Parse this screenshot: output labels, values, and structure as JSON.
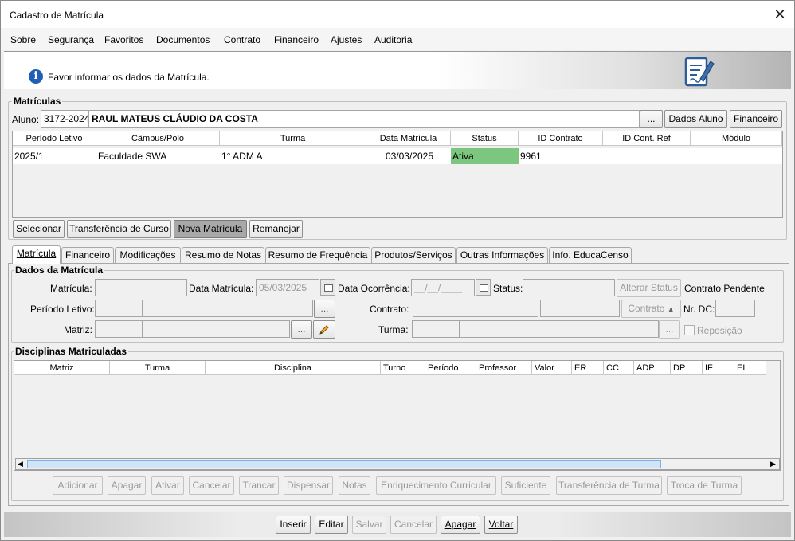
{
  "window": {
    "title": "Cadastro de Matrícula"
  },
  "menu": [
    "Sobre",
    "Segurança",
    "Favoritos",
    "Documentos",
    "Contrato",
    "Financeiro",
    "Ajustes",
    "Auditoria"
  ],
  "info": {
    "message": "Favor informar os dados da Matrícula."
  },
  "matriculas": {
    "group_title": "Matrículas",
    "aluno_label": "Aluno:",
    "aluno_code": "3172-2024",
    "aluno_name": "RAUL MATEUS CLÁUDIO DA COSTA",
    "browse_label": "...",
    "dados_aluno_label": "Dados Aluno",
    "financeiro_label": "Financeiro",
    "columns": [
      "Período Letivo",
      "Câmpus/Polo",
      "Turma",
      "Data Matrícula",
      "Status",
      "ID Contrato",
      "ID Cont. Ref",
      "Módulo"
    ],
    "rows": [
      {
        "periodo": "2025/1",
        "campus": "Faculdade SWA",
        "turma": "1° ADM A",
        "data": "03/03/2025",
        "status": "Ativa",
        "id_contrato": "9961",
        "id_ref": "",
        "modulo": ""
      }
    ],
    "status_color": "#7dc67f",
    "actions": [
      "Selecionar",
      "Transferência de Curso",
      "Nova Matrícula",
      "Remanejar"
    ]
  },
  "tabs": [
    "Matrícula",
    "Financeiro",
    "Modificações",
    "Resumo de Notas",
    "Resumo de Frequência",
    "Produtos/Serviços",
    "Outras Informações",
    "Info. EducaCenso"
  ],
  "dados": {
    "group_title": "Dados da Matrícula",
    "matricula_label": "Matrícula:",
    "data_matricula_label": "Data Matrícula:",
    "data_matricula_value": "05/03/2025",
    "data_ocorrencia_label": "Data Ocorrência:",
    "data_ocorrencia_value": "__/__/____",
    "status_label": "Status:",
    "alterar_status_label": "Alterar Status",
    "contrato_pendente_label": "Contrato Pendente",
    "periodo_letivo_label": "Período Letivo:",
    "contrato_label": "Contrato:",
    "contrato_btn_label": "Contrato",
    "nr_dc_label": "Nr. DC:",
    "matriz_label": "Matriz:",
    "turma_label": "Turma:",
    "reposicao_label": "Reposição",
    "browse_label": "..."
  },
  "disciplinas": {
    "group_title": "Disciplinas Matriculadas",
    "columns": [
      "Matriz",
      "Turma",
      "Disciplina",
      "Turno",
      "Período",
      "Professor",
      "Valor",
      "ER",
      "CC",
      "ADP",
      "DP",
      "IF",
      "EL"
    ],
    "actions": [
      "Adicionar",
      "Apagar",
      "Ativar",
      "Cancelar",
      "Trancar",
      "Dispensar",
      "Notas",
      "Enriquecimento Curricular",
      "Suficiente",
      "Transferência de Turma",
      "Troca de Turma"
    ]
  },
  "footer": {
    "actions": [
      "Inserir",
      "Editar",
      "Salvar",
      "Cancelar",
      "Apagar",
      "Voltar"
    ]
  }
}
